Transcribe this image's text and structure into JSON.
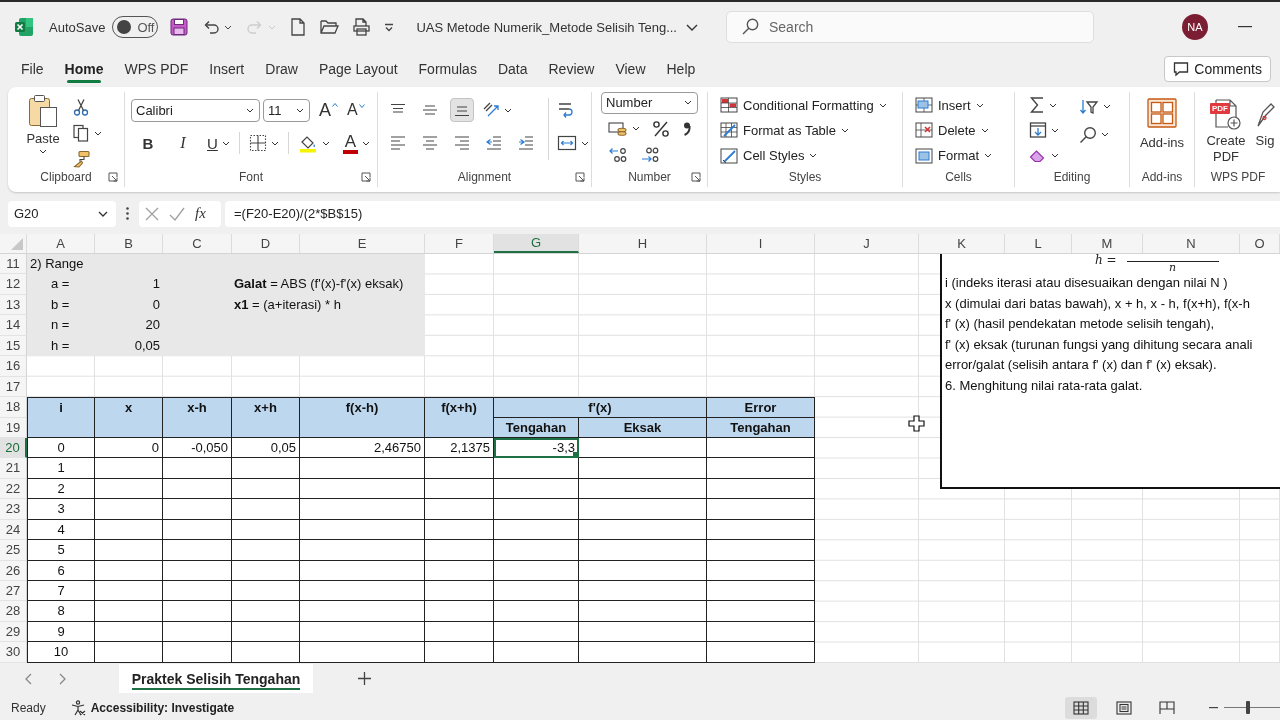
{
  "title_bar": {
    "autosave_label": "AutoSave",
    "autosave": {
      "label": "Off",
      "on": false
    },
    "quick_access": [
      {
        "kind": "save",
        "disabled": false
      },
      {
        "kind": "undo",
        "disabled": false
      },
      {
        "kind": "redo",
        "disabled": true
      },
      {
        "kind": "new",
        "disabled": false
      },
      {
        "kind": "open",
        "disabled": false
      },
      {
        "kind": "print_preview",
        "disabled": false
      }
    ],
    "document_title": "UAS Metode Numerik_Metode Selisih Teng...",
    "search": {
      "placeholder": "Search"
    },
    "account_initials": "NA"
  },
  "menu_tabs": [
    {
      "label": "File",
      "selected": false
    },
    {
      "label": "Home",
      "selected": true
    },
    {
      "label": "WPS PDF",
      "selected": false
    },
    {
      "label": "Insert",
      "selected": false
    },
    {
      "label": "Draw",
      "selected": false
    },
    {
      "label": "Page Layout",
      "selected": false
    },
    {
      "label": "Formulas",
      "selected": false
    },
    {
      "label": "Data",
      "selected": false
    },
    {
      "label": "Review",
      "selected": false
    },
    {
      "label": "View",
      "selected": false
    },
    {
      "label": "Help",
      "selected": false
    }
  ],
  "comments_button": "Comments",
  "ribbon": {
    "clipboard": {
      "label": "Clipboard",
      "paste": "Paste"
    },
    "font": {
      "label": "Font",
      "font_name": "Calibri",
      "font_size": "11",
      "grow": "A",
      "shrink": "A",
      "bold": "B",
      "italic": "I",
      "underline": "U",
      "font_color": "A"
    },
    "alignment": {
      "label": "Alignment",
      "vertical_align": [
        {
          "kind": "top",
          "selected": false
        },
        {
          "kind": "middle",
          "selected": false
        },
        {
          "kind": "bottom",
          "selected": true
        }
      ]
    },
    "number": {
      "label": "Number",
      "format": "Number"
    },
    "styles": {
      "label": "Styles",
      "buttons": [
        {
          "kind": "conditional",
          "label": "Conditional Formatting"
        },
        {
          "kind": "table",
          "label": "Format as Table"
        },
        {
          "kind": "cell_styles",
          "label": "Cell Styles"
        }
      ]
    },
    "cells": {
      "label": "Cells",
      "buttons": [
        {
          "kind": "insert",
          "label": "Insert"
        },
        {
          "kind": "delete",
          "label": "Delete"
        },
        {
          "kind": "format",
          "label": "Format"
        }
      ]
    },
    "editing": {
      "label": "Editing"
    },
    "add_ins": {
      "label": "Add-ins",
      "button": "Add-ins"
    },
    "wps_pdf": {
      "label": "WPS PDF",
      "create": {
        "label": "Create PDF",
        "badge": "PDF"
      },
      "sign": "Sig"
    }
  },
  "formula_bar": {
    "name_box": "G20",
    "function_label": "fx",
    "formula": "=(F20-E20)/(2*$B$15)"
  },
  "sheet": {
    "columns": [
      {
        "label": "A",
        "selected": false
      },
      {
        "label": "B",
        "selected": false
      },
      {
        "label": "C",
        "selected": false
      },
      {
        "label": "D",
        "selected": false
      },
      {
        "label": "E",
        "selected": false
      },
      {
        "label": "F",
        "selected": false
      },
      {
        "label": "G",
        "selected": true
      },
      {
        "label": "H",
        "selected": false
      },
      {
        "label": "I",
        "selected": false
      },
      {
        "label": "J",
        "selected": false
      },
      {
        "label": "K",
        "selected": false
      },
      {
        "label": "L",
        "selected": false
      },
      {
        "label": "M",
        "selected": false
      },
      {
        "label": "N",
        "selected": false
      },
      {
        "label": "O",
        "selected": false
      }
    ],
    "rows": [
      {
        "label": "11",
        "selected": false
      },
      {
        "label": "12",
        "selected": false
      },
      {
        "label": "13",
        "selected": false
      },
      {
        "label": "14",
        "selected": false
      },
      {
        "label": "15",
        "selected": false
      },
      {
        "label": "16",
        "selected": false
      },
      {
        "label": "17",
        "selected": false
      },
      {
        "label": "18",
        "selected": false
      },
      {
        "label": "19",
        "selected": false
      },
      {
        "label": "20",
        "selected": true
      },
      {
        "label": "21",
        "selected": false
      },
      {
        "label": "22",
        "selected": false
      },
      {
        "label": "23",
        "selected": false
      },
      {
        "label": "24",
        "selected": false
      },
      {
        "label": "25",
        "selected": false
      },
      {
        "label": "26",
        "selected": false
      },
      {
        "label": "27",
        "selected": false
      },
      {
        "label": "28",
        "selected": false
      },
      {
        "label": "29",
        "selected": false
      },
      {
        "label": "30",
        "selected": false
      }
    ],
    "range_block": {
      "title": "2) Range",
      "params": [
        {
          "name": "a =",
          "value": "1"
        },
        {
          "name": "b =",
          "value": "0"
        },
        {
          "name": "n =",
          "value": "20"
        },
        {
          "name": "h =",
          "value": "0,05"
        }
      ],
      "notes": [
        "**Galat** = ABS (f'(x)-f'(x) eksak)",
        "**x1** = (a+iterasi) * h"
      ]
    },
    "table": {
      "columns": [
        {
          "label": "i"
        },
        {
          "label": "x"
        },
        {
          "label": "x-h"
        },
        {
          "label": "x+h"
        },
        {
          "label": "f(x-h)"
        },
        {
          "label": "f(x+h)"
        },
        {
          "label": "f'(x)",
          "subcolumns": [
            "Tengahan",
            "Eksak"
          ]
        },
        {
          "label": "Error",
          "subcolumns": [
            "Tengahan"
          ]
        }
      ],
      "rows": [
        [
          "0",
          "0",
          "-0,050",
          "0,05",
          "2,46750",
          "2,1375",
          "-3,3",
          null,
          null
        ],
        [
          "1",
          null,
          null,
          null,
          null,
          null,
          null,
          null,
          null
        ],
        [
          "2",
          null,
          null,
          null,
          null,
          null,
          null,
          null,
          null
        ],
        [
          "3",
          null,
          null,
          null,
          null,
          null,
          null,
          null,
          null
        ],
        [
          "4",
          null,
          null,
          null,
          null,
          null,
          null,
          null,
          null
        ],
        [
          "5",
          null,
          null,
          null,
          null,
          null,
          null,
          null,
          null
        ],
        [
          "6",
          null,
          null,
          null,
          null,
          null,
          null,
          null,
          null
        ],
        [
          "7",
          null,
          null,
          null,
          null,
          null,
          null,
          null,
          null
        ],
        [
          "8",
          null,
          null,
          null,
          null,
          null,
          null,
          null,
          null
        ],
        [
          "9",
          null,
          null,
          null,
          null,
          null,
          null,
          null,
          null
        ],
        [
          "10",
          null,
          null,
          null,
          null,
          null,
          null,
          null,
          null
        ]
      ]
    },
    "text_box": {
      "equation": {
        "lhs": "h =",
        "denominator": "n"
      },
      "lines": [
        "i (indeks iterasi atau disesuaikan dengan nilai N )",
        "x (dimulai dari batas bawah), x + h, x - h, f(x+h), f(x-h",
        "f' (x) (hasil pendekatan metode selisih tengah),",
        "f' (x) eksak (turunan fungsi yang dihitung secara anali",
        "error/galat (selisih antara f' (x) dan f' (x) eksak).",
        "6. Menghitung nilai rata-rata galat."
      ]
    }
  },
  "sheet_tabs": [
    {
      "label": "Praktek Selisih Tengahan",
      "selected": true
    }
  ],
  "status_bar": {
    "status": "Ready",
    "accessibility": "Accessibility: Investigate",
    "views": [
      {
        "kind": "normal",
        "selected": true
      },
      {
        "kind": "page_layout",
        "selected": false
      },
      {
        "kind": "page_break",
        "selected": false
      }
    ],
    "zoom": {
      "level": 0.43
    }
  }
}
